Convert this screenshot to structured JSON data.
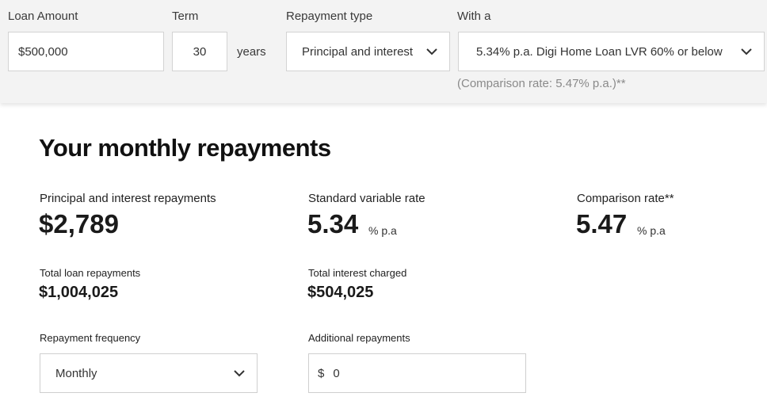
{
  "calculator": {
    "loan_amount_label": "Loan Amount",
    "loan_amount_value": "$500,000",
    "term_label": "Term",
    "term_value": "30",
    "term_unit": "years",
    "repayment_type_label": "Repayment type",
    "repayment_type_value": "Principal and interest",
    "with_label": "With a",
    "product_value": "5.34% p.a. Digi Home Loan LVR 60% or below",
    "comparison_note": "(Comparison rate: 5.47% p.a.)**"
  },
  "results": {
    "title": "Your monthly repayments",
    "pi_label": "Principal and interest repayments",
    "pi_value": "$2,789",
    "svr_label": "Standard variable rate",
    "svr_value": "5.34",
    "svr_unit": "% p.a",
    "comp_label": "Comparison rate**",
    "comp_value": "5.47",
    "comp_unit": "% p.a",
    "total_repay_label": "Total loan repayments",
    "total_repay_value": "$1,004,025",
    "total_interest_label": "Total interest charged",
    "total_interest_value": "$504,025",
    "freq_label": "Repayment frequency",
    "freq_value": "Monthly",
    "additional_label": "Additional repayments",
    "additional_prefix": "$",
    "additional_value": "0"
  },
  "icons": {
    "dropdown": "chevron-down-icon"
  },
  "colors": {
    "panel_bg": "#f3f3f3",
    "border": "#d3d3d3",
    "muted_text": "#8a8a8a"
  }
}
